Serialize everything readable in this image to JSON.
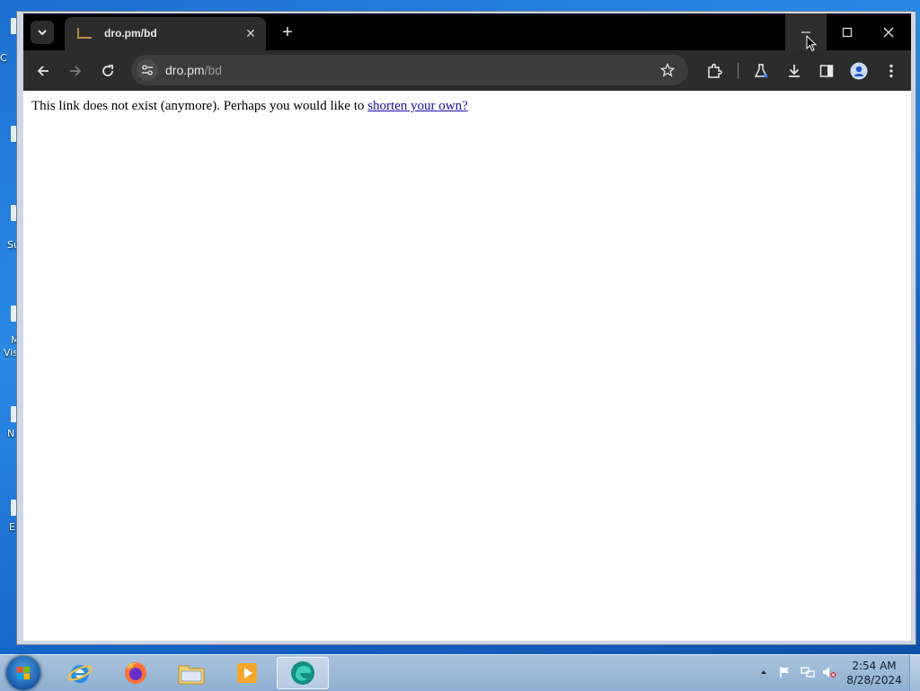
{
  "desktop": {
    "icon_labels": [
      "C",
      "Su",
      "M",
      "Vis",
      "N",
      "E"
    ]
  },
  "browser": {
    "tab": {
      "title": "dro.pm/bd",
      "close_glyph": "✕"
    },
    "new_tab_glyph": "+",
    "window_controls": {
      "minimize": "—",
      "maximize": "☐",
      "close": "✕"
    },
    "address": {
      "host": "dro.pm",
      "path": "/bd"
    },
    "icons": {
      "tabs_menu": "chevron-down-icon",
      "back": "arrow-left-icon",
      "forward": "arrow-right-icon",
      "reload": "reload-icon",
      "site_info": "tune-icon",
      "bookmark": "star-icon",
      "extensions": "puzzle-icon",
      "labs": "flask-icon",
      "downloads": "download-icon",
      "side_panel": "side-panel-icon",
      "profile": "profile-icon",
      "menu": "kebab-menu-icon"
    }
  },
  "page": {
    "message": "This link does not exist (anymore). Perhaps you would like to ",
    "link_text": "shorten your own?"
  },
  "taskbar": {
    "apps": [
      "internet-explorer",
      "firefox",
      "file-explorer",
      "media-player",
      "edge"
    ],
    "clock_time": "2:54 AM",
    "clock_date": "8/28/2024"
  }
}
